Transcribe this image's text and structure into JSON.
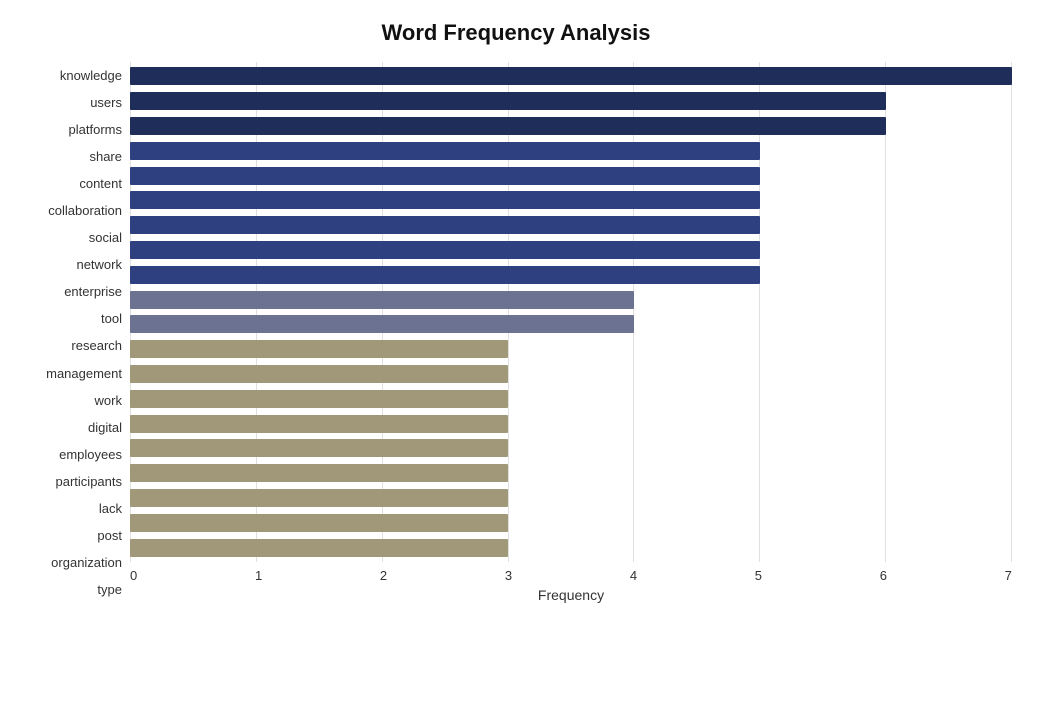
{
  "chart": {
    "title": "Word Frequency Analysis",
    "x_axis_label": "Frequency",
    "x_ticks": [
      "0",
      "1",
      "2",
      "3",
      "4",
      "5",
      "6",
      "7"
    ],
    "max_value": 7,
    "bars": [
      {
        "label": "knowledge",
        "value": 7,
        "color": "dark-navy"
      },
      {
        "label": "users",
        "value": 6,
        "color": "dark-navy"
      },
      {
        "label": "platforms",
        "value": 6,
        "color": "dark-navy"
      },
      {
        "label": "share",
        "value": 5,
        "color": "medium-navy"
      },
      {
        "label": "content",
        "value": 5,
        "color": "medium-navy"
      },
      {
        "label": "collaboration",
        "value": 5,
        "color": "medium-navy"
      },
      {
        "label": "social",
        "value": 5,
        "color": "medium-navy"
      },
      {
        "label": "network",
        "value": 5,
        "color": "medium-navy"
      },
      {
        "label": "enterprise",
        "value": 5,
        "color": "medium-navy"
      },
      {
        "label": "tool",
        "value": 4,
        "color": "slate"
      },
      {
        "label": "research",
        "value": 4,
        "color": "slate"
      },
      {
        "label": "management",
        "value": 3,
        "color": "tan"
      },
      {
        "label": "work",
        "value": 3,
        "color": "tan"
      },
      {
        "label": "digital",
        "value": 3,
        "color": "tan"
      },
      {
        "label": "employees",
        "value": 3,
        "color": "tan"
      },
      {
        "label": "participants",
        "value": 3,
        "color": "tan"
      },
      {
        "label": "lack",
        "value": 3,
        "color": "tan"
      },
      {
        "label": "post",
        "value": 3,
        "color": "tan"
      },
      {
        "label": "organization",
        "value": 3,
        "color": "tan"
      },
      {
        "label": "type",
        "value": 3,
        "color": "tan"
      }
    ]
  }
}
